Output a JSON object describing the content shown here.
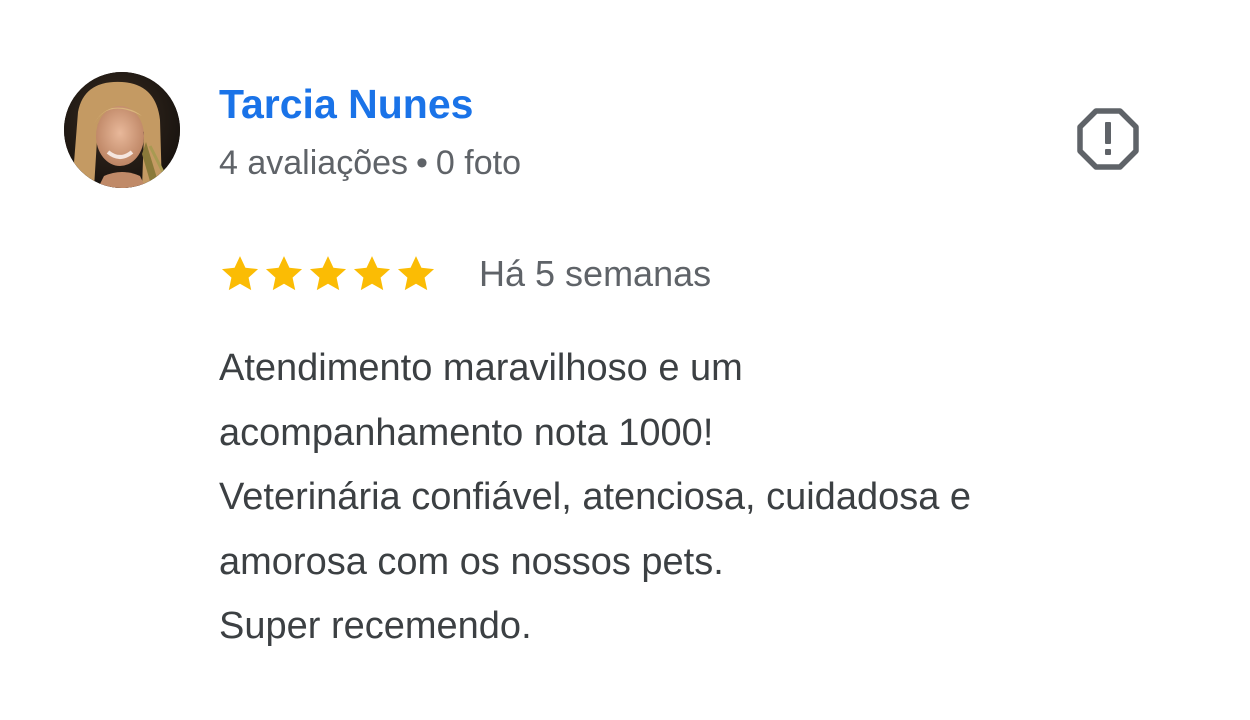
{
  "review": {
    "author": {
      "name": "Tarcia Nunes",
      "reviews_count": "4 avaliações",
      "separator": "•",
      "photos_count": "0 foto"
    },
    "rating": {
      "stars": 5,
      "max_stars": 5,
      "star_color": "#fbbc04"
    },
    "date": "Há 5 semanas",
    "text_lines": [
      "Atendimento maravilhoso e um",
      "acompanhamento nota 1000!",
      "Veterinária confiável, atenciosa, cuidadosa e",
      "amorosa com os nossos pets.",
      "Super recemendo."
    ],
    "report_icon": "report-octagon-exclamation-icon"
  },
  "colors": {
    "name_link": "#1a73e8",
    "meta_text": "#5f6368",
    "body_text": "#3c4043",
    "icon": "#5f6368"
  }
}
